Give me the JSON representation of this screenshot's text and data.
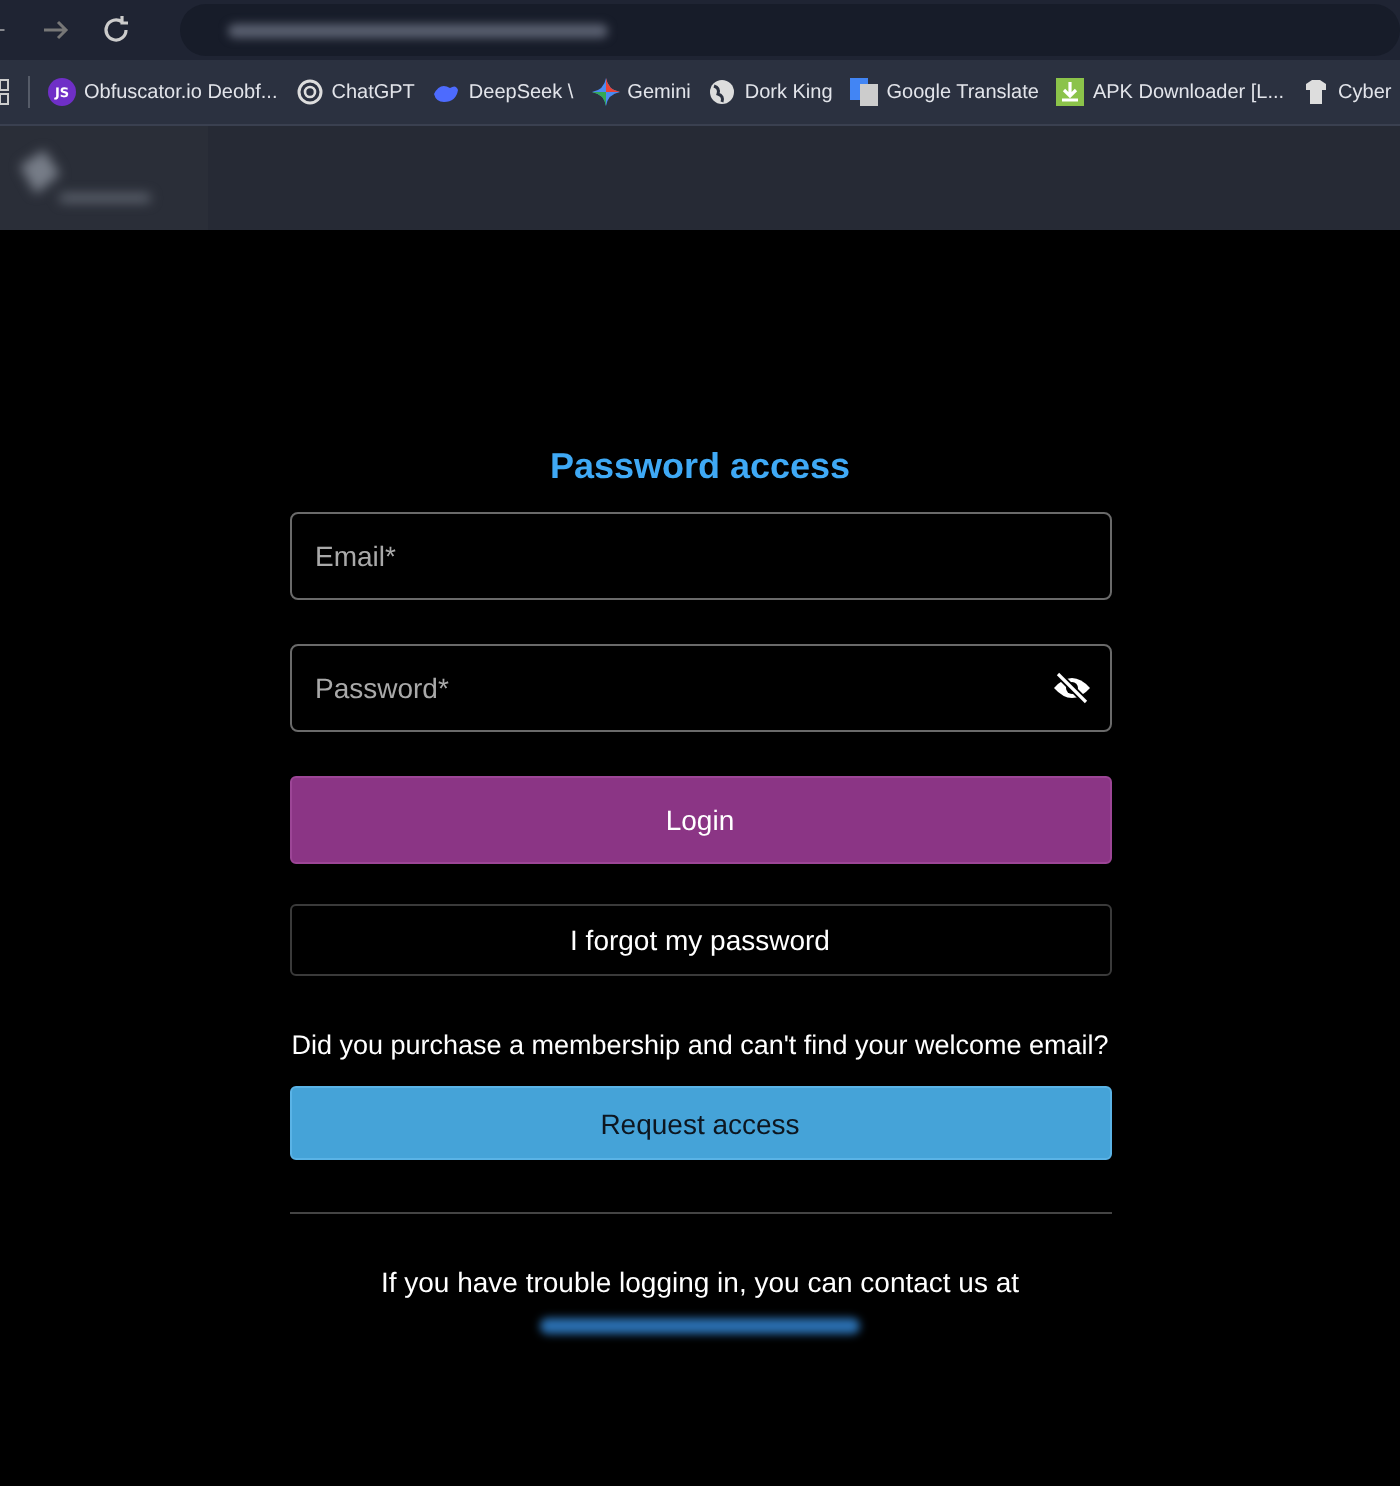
{
  "bookmarks": [
    {
      "label": "Obfuscator.io Deobf...",
      "icon_text": "JS"
    },
    {
      "label": "ChatGPT"
    },
    {
      "label": "DeepSeek \\"
    },
    {
      "label": "Gemini"
    },
    {
      "label": "Dork King"
    },
    {
      "label": "Google Translate"
    },
    {
      "label": "APK Downloader [L..."
    },
    {
      "label": "Cyber"
    }
  ],
  "form": {
    "title": "Password access",
    "fields": [
      {
        "placeholder": "Email*",
        "kind": "email"
      },
      {
        "placeholder": "Password*",
        "kind": "password"
      }
    ],
    "login_button": "Login",
    "forgot_button": "I forgot my password",
    "membership_question": "Did you purchase a membership and can't find your welcome email?",
    "request_button": "Request access",
    "contact_text": "If you have trouble logging in, you can contact us at"
  }
}
